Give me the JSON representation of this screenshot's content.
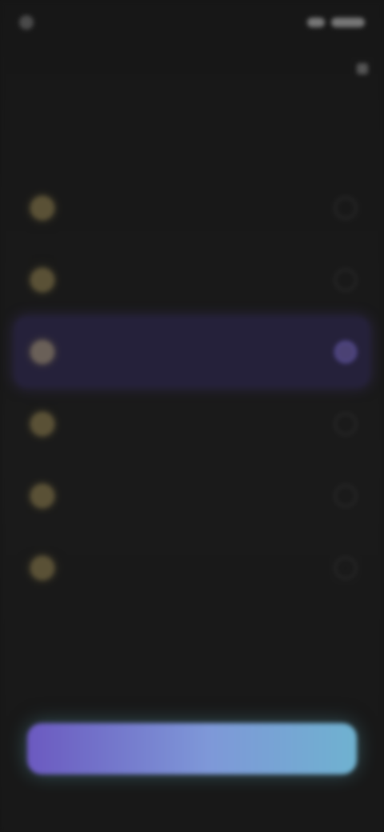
{
  "status_bar": {
    "time": "",
    "icons": [
      "signal-icon",
      "battery-icon"
    ]
  },
  "header": {
    "back_label": "",
    "more_icon": "more-icon"
  },
  "question": {
    "title": ""
  },
  "options": [
    {
      "label": "",
      "hint": "",
      "badge_icon": "circle-badge-icon",
      "selected": false
    },
    {
      "label": "",
      "hint": "",
      "badge_icon": "circle-badge-icon",
      "selected": false
    },
    {
      "label": "",
      "hint": "",
      "badge_icon": "circle-badge-icon",
      "selected": true
    },
    {
      "label": "",
      "hint": "",
      "badge_icon": "circle-badge-icon",
      "selected": false
    },
    {
      "label": "",
      "hint": "",
      "badge_icon": "circle-badge-icon",
      "selected": false
    },
    {
      "label": "",
      "hint": "",
      "badge_icon": "circle-badge-icon",
      "selected": false
    }
  ],
  "cta": {
    "label": ""
  },
  "colors": {
    "background": "#161616",
    "selected_background": "#25213a",
    "accent": "#6b59c0",
    "cta_end": "#6fb2d0",
    "badge": "#5a5136"
  }
}
